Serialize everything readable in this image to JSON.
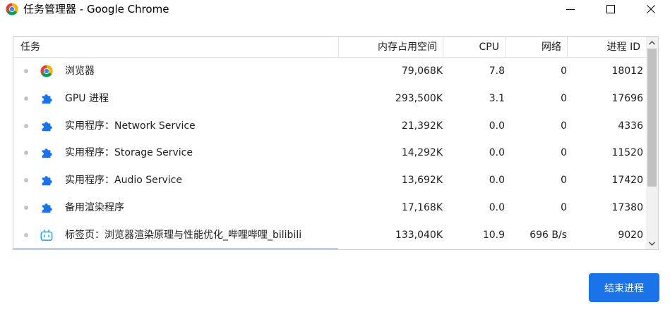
{
  "window": {
    "title": "任务管理器 - Google Chrome",
    "icon": "chrome-icon",
    "controls": [
      "minimize-icon",
      "maximize-icon",
      "close-icon"
    ]
  },
  "table": {
    "headers": {
      "task": "任务",
      "memory": "内存占用空间",
      "cpu": "CPU",
      "network": "网络",
      "pid": "进程 ID"
    },
    "rows": [
      {
        "icon": "chrome-icon",
        "task": "浏览器",
        "memory": "79,068K",
        "cpu": "7.8",
        "network": "0",
        "pid": "18012"
      },
      {
        "icon": "puzzle-icon",
        "task": "GPU 进程",
        "memory": "293,500K",
        "cpu": "3.1",
        "network": "0",
        "pid": "17696"
      },
      {
        "icon": "puzzle-icon",
        "task": "实用程序：Network Service",
        "memory": "21,392K",
        "cpu": "0.0",
        "network": "0",
        "pid": "4336"
      },
      {
        "icon": "puzzle-icon",
        "task": "实用程序：Storage Service",
        "memory": "14,292K",
        "cpu": "0.0",
        "network": "0",
        "pid": "11520"
      },
      {
        "icon": "puzzle-icon",
        "task": "实用程序：Audio Service",
        "memory": "13,692K",
        "cpu": "0.0",
        "network": "0",
        "pid": "17420"
      },
      {
        "icon": "puzzle-icon",
        "task": "备用渲染程序",
        "memory": "17,168K",
        "cpu": "0.0",
        "network": "0",
        "pid": "17380"
      },
      {
        "icon": "bilibili-icon",
        "task": "标签页：浏览器渲染原理与性能优化_哔哩哔哩_bilibili",
        "memory": "133,040K",
        "cpu": "10.9",
        "network": "696 B/s",
        "pid": "9020"
      }
    ]
  },
  "actions": {
    "end_process": "结束进程"
  },
  "colors": {
    "accent": "#1a73e8",
    "puzzle": "#1a73e8",
    "bilibili": "#23ade5",
    "dot": "#c4c4c4"
  }
}
